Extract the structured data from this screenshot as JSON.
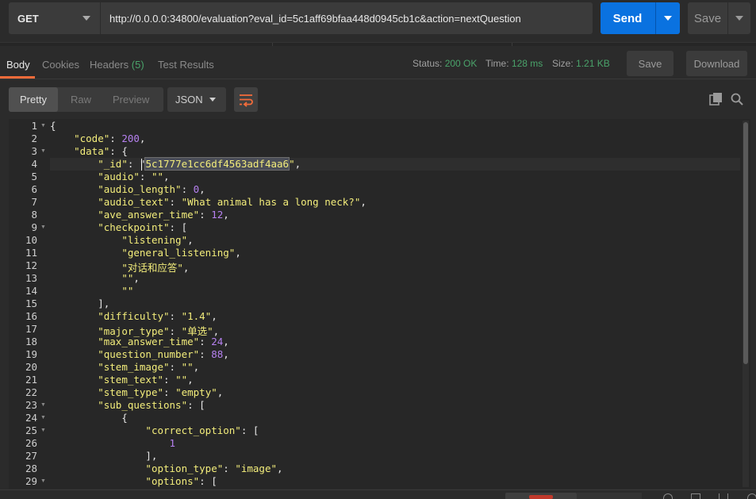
{
  "request": {
    "method": "GET",
    "url": "http://0.0.0.0:34800/evaluation?eval_id=5c1aff69bfaa448d0945cb1c&action=nextQuestion",
    "send_label": "Send",
    "save_label": "Save"
  },
  "response_tabs": [
    {
      "label": "Body"
    },
    {
      "label": "Cookies"
    },
    {
      "label": "Headers",
      "count": "(5)"
    },
    {
      "label": "Test Results"
    }
  ],
  "status": {
    "status_label": "Status:",
    "status_value": "200 OK",
    "time_label": "Time:",
    "time_value": "128 ms",
    "size_label": "Size:",
    "size_value": "1.21 KB"
  },
  "response_actions": {
    "save_label": "Save",
    "download_label": "Download"
  },
  "format": {
    "modes": [
      "Pretty",
      "Raw",
      "Preview"
    ],
    "language": "JSON"
  },
  "colors": {
    "accent": "#0a72e0",
    "tab_underline": "#f26b3a",
    "status_ok": "#4aa36a",
    "key": "#f3ed7b",
    "number": "#b681f0"
  },
  "code": {
    "lines": [
      {
        "n": "1",
        "fold": true,
        "t": [
          [
            "p",
            "{"
          ]
        ]
      },
      {
        "n": "2",
        "t": [
          [
            "p",
            "    "
          ],
          [
            "k",
            "\"code\""
          ],
          [
            "p",
            ": "
          ],
          [
            "n",
            "200"
          ],
          [
            "p",
            ","
          ]
        ]
      },
      {
        "n": "3",
        "fold": true,
        "t": [
          [
            "p",
            "    "
          ],
          [
            "k",
            "\"data\""
          ],
          [
            "p",
            ": {"
          ]
        ]
      },
      {
        "n": "4",
        "t": [
          [
            "p",
            "        "
          ],
          [
            "k",
            "\"_id\""
          ],
          [
            "p",
            ": \""
          ],
          [
            "sel",
            "5c1777e1cc6df4563adf4aa6"
          ],
          [
            "s",
            "\""
          ],
          [
            "p",
            ","
          ]
        ]
      },
      {
        "n": "5",
        "t": [
          [
            "p",
            "        "
          ],
          [
            "k",
            "\"audio\""
          ],
          [
            "p",
            ": "
          ],
          [
            "s",
            "\"\""
          ],
          [
            "p",
            ","
          ]
        ]
      },
      {
        "n": "6",
        "t": [
          [
            "p",
            "        "
          ],
          [
            "k",
            "\"audio_length\""
          ],
          [
            "p",
            ": "
          ],
          [
            "n",
            "0"
          ],
          [
            "p",
            ","
          ]
        ]
      },
      {
        "n": "7",
        "t": [
          [
            "p",
            "        "
          ],
          [
            "k",
            "\"audio_text\""
          ],
          [
            "p",
            ": "
          ],
          [
            "s",
            "\"What animal has a long neck?\""
          ],
          [
            "p",
            ","
          ]
        ]
      },
      {
        "n": "8",
        "t": [
          [
            "p",
            "        "
          ],
          [
            "k",
            "\"ave_answer_time\""
          ],
          [
            "p",
            ": "
          ],
          [
            "n",
            "12"
          ],
          [
            "p",
            ","
          ]
        ]
      },
      {
        "n": "9",
        "fold": true,
        "t": [
          [
            "p",
            "        "
          ],
          [
            "k",
            "\"checkpoint\""
          ],
          [
            "p",
            ": ["
          ]
        ]
      },
      {
        "n": "10",
        "t": [
          [
            "p",
            "            "
          ],
          [
            "s",
            "\"listening\""
          ],
          [
            "p",
            ","
          ]
        ]
      },
      {
        "n": "11",
        "t": [
          [
            "p",
            "            "
          ],
          [
            "s",
            "\"general_listening\""
          ],
          [
            "p",
            ","
          ]
        ]
      },
      {
        "n": "12",
        "t": [
          [
            "p",
            "            "
          ],
          [
            "s",
            "\"对话和应答\""
          ],
          [
            "p",
            ","
          ]
        ]
      },
      {
        "n": "13",
        "t": [
          [
            "p",
            "            "
          ],
          [
            "s",
            "\"\""
          ],
          [
            "p",
            ","
          ]
        ]
      },
      {
        "n": "14",
        "t": [
          [
            "p",
            "            "
          ],
          [
            "s",
            "\"\""
          ]
        ]
      },
      {
        "n": "15",
        "t": [
          [
            "p",
            "        ],"
          ]
        ]
      },
      {
        "n": "16",
        "t": [
          [
            "p",
            "        "
          ],
          [
            "k",
            "\"difficulty\""
          ],
          [
            "p",
            ": "
          ],
          [
            "s",
            "\"1.4\""
          ],
          [
            "p",
            ","
          ]
        ]
      },
      {
        "n": "17",
        "t": [
          [
            "p",
            "        "
          ],
          [
            "k",
            "\"major_type\""
          ],
          [
            "p",
            ": "
          ],
          [
            "s",
            "\"单选\""
          ],
          [
            "p",
            ","
          ]
        ]
      },
      {
        "n": "18",
        "t": [
          [
            "p",
            "        "
          ],
          [
            "k",
            "\"max_answer_time\""
          ],
          [
            "p",
            ": "
          ],
          [
            "n",
            "24"
          ],
          [
            "p",
            ","
          ]
        ]
      },
      {
        "n": "19",
        "t": [
          [
            "p",
            "        "
          ],
          [
            "k",
            "\"question_number\""
          ],
          [
            "p",
            ": "
          ],
          [
            "n",
            "88"
          ],
          [
            "p",
            ","
          ]
        ]
      },
      {
        "n": "20",
        "t": [
          [
            "p",
            "        "
          ],
          [
            "k",
            "\"stem_image\""
          ],
          [
            "p",
            ": "
          ],
          [
            "s",
            "\"\""
          ],
          [
            "p",
            ","
          ]
        ]
      },
      {
        "n": "21",
        "t": [
          [
            "p",
            "        "
          ],
          [
            "k",
            "\"stem_text\""
          ],
          [
            "p",
            ": "
          ],
          [
            "s",
            "\"\""
          ],
          [
            "p",
            ","
          ]
        ]
      },
      {
        "n": "22",
        "t": [
          [
            "p",
            "        "
          ],
          [
            "k",
            "\"stem_type\""
          ],
          [
            "p",
            ": "
          ],
          [
            "s",
            "\"empty\""
          ],
          [
            "p",
            ","
          ]
        ]
      },
      {
        "n": "23",
        "fold": true,
        "t": [
          [
            "p",
            "        "
          ],
          [
            "k",
            "\"sub_questions\""
          ],
          [
            "p",
            ": ["
          ]
        ]
      },
      {
        "n": "24",
        "fold": true,
        "t": [
          [
            "p",
            "            {"
          ]
        ]
      },
      {
        "n": "25",
        "fold": true,
        "t": [
          [
            "p",
            "                "
          ],
          [
            "k",
            "\"correct_option\""
          ],
          [
            "p",
            ": ["
          ]
        ]
      },
      {
        "n": "26",
        "t": [
          [
            "p",
            "                    "
          ],
          [
            "n",
            "1"
          ]
        ]
      },
      {
        "n": "27",
        "t": [
          [
            "p",
            "                ],"
          ]
        ]
      },
      {
        "n": "28",
        "t": [
          [
            "p",
            "                "
          ],
          [
            "k",
            "\"option_type\""
          ],
          [
            "p",
            ": "
          ],
          [
            "s",
            "\"image\""
          ],
          [
            "p",
            ","
          ]
        ]
      },
      {
        "n": "29",
        "fold": true,
        "t": [
          [
            "p",
            "                "
          ],
          [
            "k",
            "\"options\""
          ],
          [
            "p",
            ": ["
          ]
        ]
      }
    ]
  }
}
